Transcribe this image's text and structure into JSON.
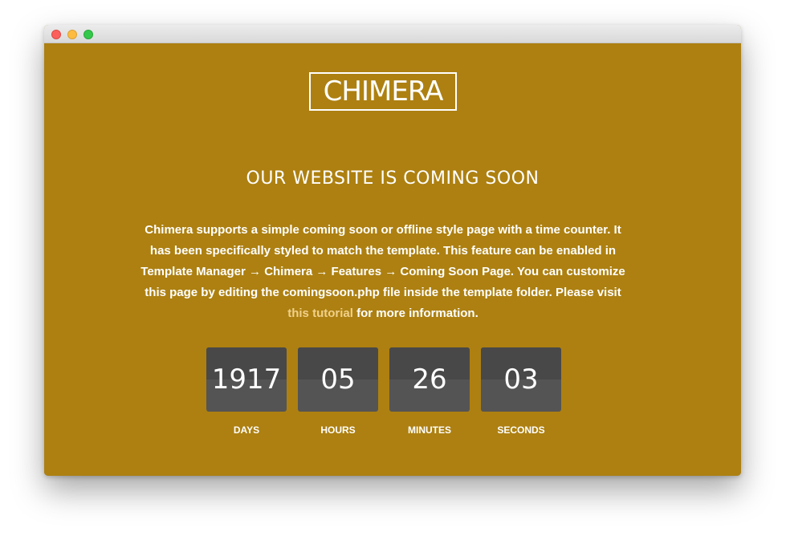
{
  "window": {
    "buttons": {
      "close": "close",
      "minimize": "minimize",
      "maximize": "maximize"
    }
  },
  "logo": {
    "text": "CHIMERA"
  },
  "headline": "OUR WEBSITE IS COMING SOON",
  "description": {
    "text": "Chimera supports a simple coming soon or offline style page with a time counter. It has been specifically styled to match the template. This feature can be enabled in Template Manager → Chimera → Features → Coming Soon Page. You can customize this page by editing the comingsoon.php file inside the template folder. Please visit ",
    "link_text": "this tutorial",
    "suffix": " for more information."
  },
  "countdown": [
    {
      "value": "1917",
      "label": "DAYS"
    },
    {
      "value": "05",
      "label": "HOURS"
    },
    {
      "value": "26",
      "label": "MINUTES"
    },
    {
      "value": "03",
      "label": "SECONDS"
    }
  ],
  "colors": {
    "background": "#ad8011",
    "counter_dark": "#484848",
    "counter_light": "#545454",
    "link": "#f1d08a",
    "text": "#ffffff"
  }
}
